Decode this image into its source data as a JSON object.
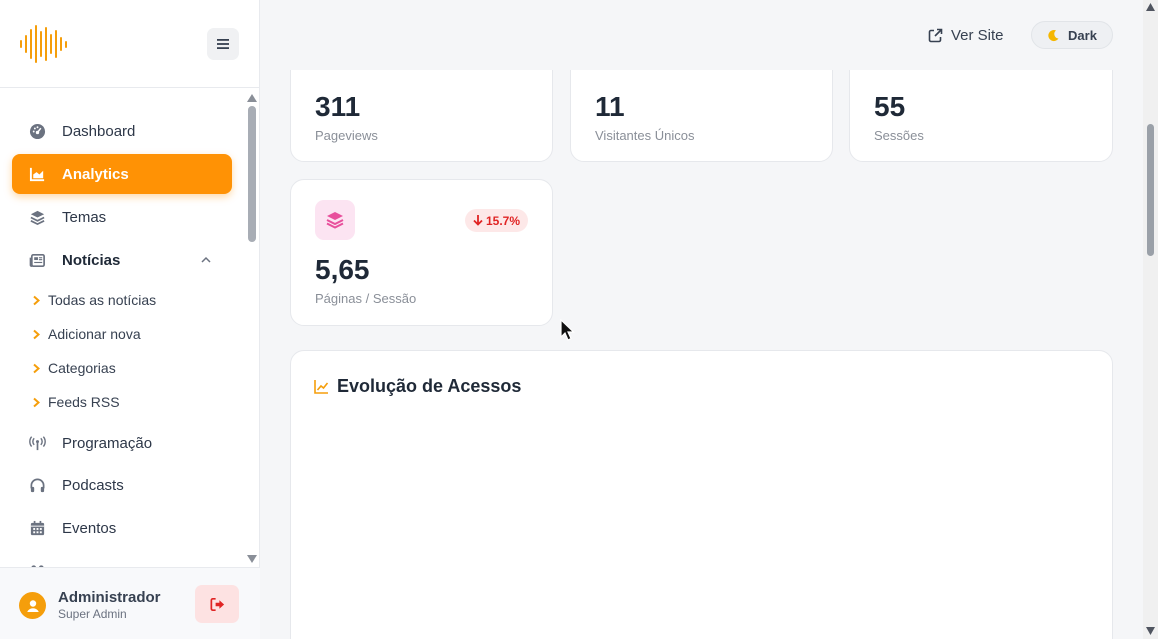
{
  "sidebar": {
    "toggle_icon": "hamburger-icon",
    "nav": [
      {
        "label": "Dashboard",
        "icon": "gauge-icon"
      },
      {
        "label": "Analytics",
        "icon": "area-chart-icon",
        "active": true
      },
      {
        "label": "Temas",
        "icon": "layers-icon"
      },
      {
        "label": "Notícias",
        "icon": "newspaper-icon",
        "expanded": true
      },
      {
        "label": "Programação",
        "icon": "broadcast-icon"
      },
      {
        "label": "Podcasts",
        "icon": "headphones-icon"
      },
      {
        "label": "Eventos",
        "icon": "calendar-icon"
      }
    ],
    "subnav": [
      {
        "label": "Todas as notícias"
      },
      {
        "label": "Adicionar nova"
      },
      {
        "label": "Categorias"
      },
      {
        "label": "Feeds RSS"
      }
    ],
    "user": {
      "name": "Administrador",
      "role": "Super Admin"
    }
  },
  "header": {
    "ver_site": "Ver Site",
    "theme_toggle": "Dark"
  },
  "stats": [
    {
      "value": "311",
      "label": "Pageviews"
    },
    {
      "value": "11",
      "label": "Visitantes Únicos"
    },
    {
      "value": "55",
      "label": "Sessões"
    },
    {
      "value": "5,65",
      "label": "Páginas / Sessão",
      "trend": "15.7%",
      "trend_direction": "down"
    }
  ],
  "chart": {
    "title": "Evolução de Acessos"
  },
  "colors": {
    "accent": "#ff9205",
    "trend_down": "#e02424",
    "pink_icon": "#e84f9c"
  }
}
